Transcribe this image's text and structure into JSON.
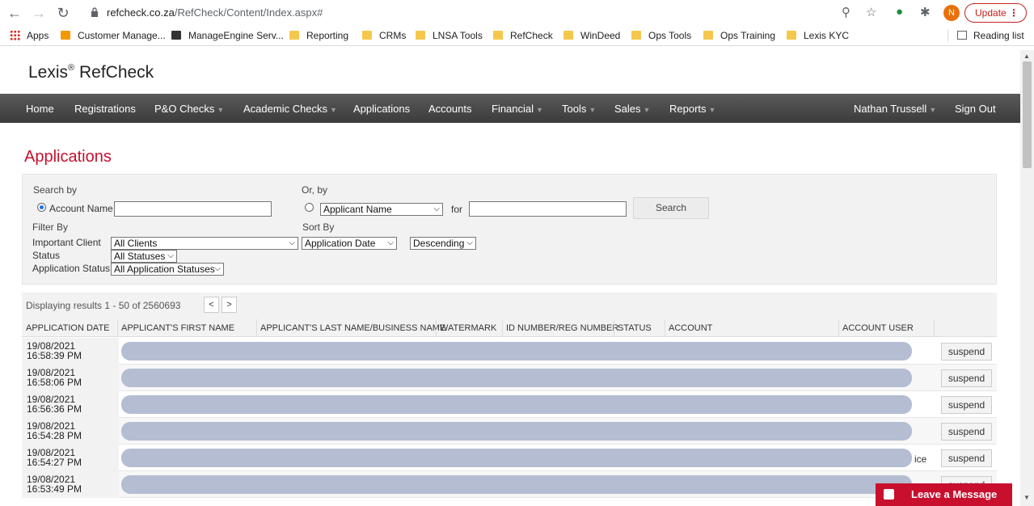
{
  "browser": {
    "url_host": "refcheck.co.za",
    "url_path": "/RefCheck/Content/Index.aspx#",
    "avatar_letter": "N",
    "update_label": "Update",
    "bookmarks": [
      "Apps",
      "Customer Manage...",
      "ManageEngine Serv...",
      "Reporting",
      "CRMs",
      "LNSA Tools",
      "RefCheck",
      "WinDeed",
      "Ops Tools",
      "Ops Training",
      "Lexis KYC"
    ],
    "reading_list": "Reading list"
  },
  "site": {
    "logo": "Lexis",
    "logo_mark": "®",
    "logo_product": " RefCheck",
    "nav": [
      "Home",
      "Registrations",
      "P&O Checks",
      "Academic Checks",
      "Applications",
      "Accounts",
      "Financial",
      "Tools",
      "Sales",
      "Reports"
    ],
    "user": "Nathan Trussell",
    "signout": "Sign Out"
  },
  "page_title": "Applications",
  "search": {
    "search_by": "Search by",
    "account_name_label": "Account Name",
    "or_by": "Or, by",
    "or_by_select": "Applicant Name",
    "for_label": "for",
    "search_button": "Search",
    "filter_by": "Filter By",
    "important_client_label": "Important Client",
    "important_client_value": "All Clients",
    "status_label": "Status",
    "status_value": "All Statuses",
    "app_status_label": "Application Status",
    "app_status_value": "All Application Statuses",
    "sort_by": "Sort By",
    "sort_field": "Application Date",
    "sort_order": "Descending"
  },
  "results": {
    "summary": "Displaying results 1 - 50 of 2560693",
    "prev": "<",
    "next": ">",
    "columns": [
      "APPLICATION DATE",
      "APPLICANT'S FIRST NAME",
      "APPLICANT'S LAST NAME/BUSINESS NAME",
      "WATERMARK",
      "ID NUMBER/REG NUMBER",
      "STATUS",
      "ACCOUNT",
      "ACCOUNT USER"
    ],
    "rows": [
      {
        "date": "19/08/2021 16:58:39 PM",
        "action": "suspend"
      },
      {
        "date": "19/08/2021 16:58:06 PM",
        "action": "suspend"
      },
      {
        "date": "19/08/2021 16:56:36 PM",
        "action": "suspend"
      },
      {
        "date": "19/08/2021 16:54:28 PM",
        "action": "suspend"
      },
      {
        "date": "19/08/2021 16:54:27 PM",
        "action": "suspend",
        "peek": "ice"
      },
      {
        "date": "19/08/2021 16:53:49 PM",
        "action": "suspend"
      }
    ]
  },
  "chat": {
    "label": "Leave a Message"
  },
  "colors": {
    "brand_red": "#c8102e",
    "nav_dark": "#3b3b3b",
    "redaction": "#b4bdd2"
  }
}
